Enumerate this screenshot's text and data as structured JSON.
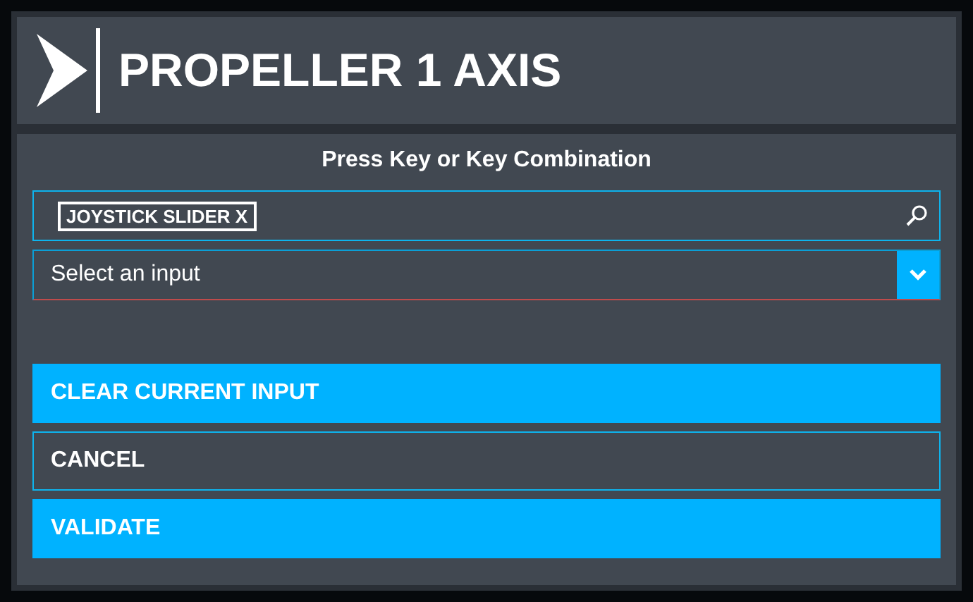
{
  "window": {
    "title": "PROPELLER 1 AXIS"
  },
  "prompt": "Press Key or Key Combination",
  "search": {
    "tag": "JOYSTICK SLIDER X"
  },
  "input_select": {
    "placeholder": "Select an input"
  },
  "buttons": [
    {
      "label": "CLEAR CURRENT INPUT",
      "kind": "primary"
    },
    {
      "label": "CANCEL",
      "kind": "secondary"
    },
    {
      "label": "VALIDATE",
      "kind": "primary"
    }
  ]
}
